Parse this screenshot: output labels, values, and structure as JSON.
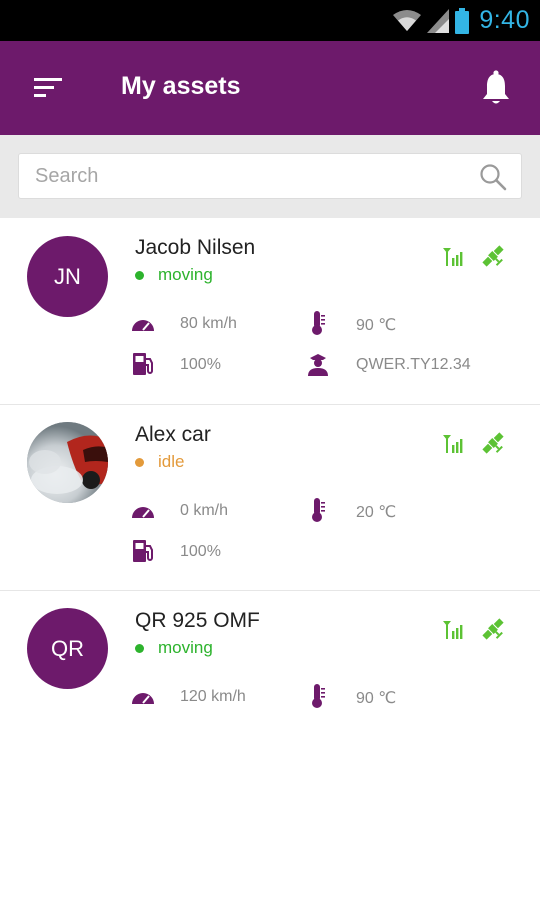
{
  "status_bar": {
    "time": "9:40"
  },
  "app_bar": {
    "title": "My assets"
  },
  "search": {
    "placeholder": "Search"
  },
  "colors": {
    "brand": "#6d1a6b",
    "moving": "#2db32d",
    "idle": "#e39a3b",
    "sensor": "#5cc234",
    "time": "#33b5e5"
  },
  "assets": [
    {
      "initials": "JN",
      "name": "Jacob Nilsen",
      "status": "moving",
      "speed": "80 km/h",
      "temperature": "90 ℃",
      "fuel": "100%",
      "driver": "QWER.TY12.34"
    },
    {
      "name": "Alex car",
      "status": "idle",
      "speed": "0 km/h",
      "temperature": "20 ℃",
      "fuel": "100%"
    },
    {
      "initials": "QR",
      "name": "QR 925 OMF",
      "status": "moving",
      "speed": "120 km/h",
      "temperature": "90 ℃"
    }
  ]
}
